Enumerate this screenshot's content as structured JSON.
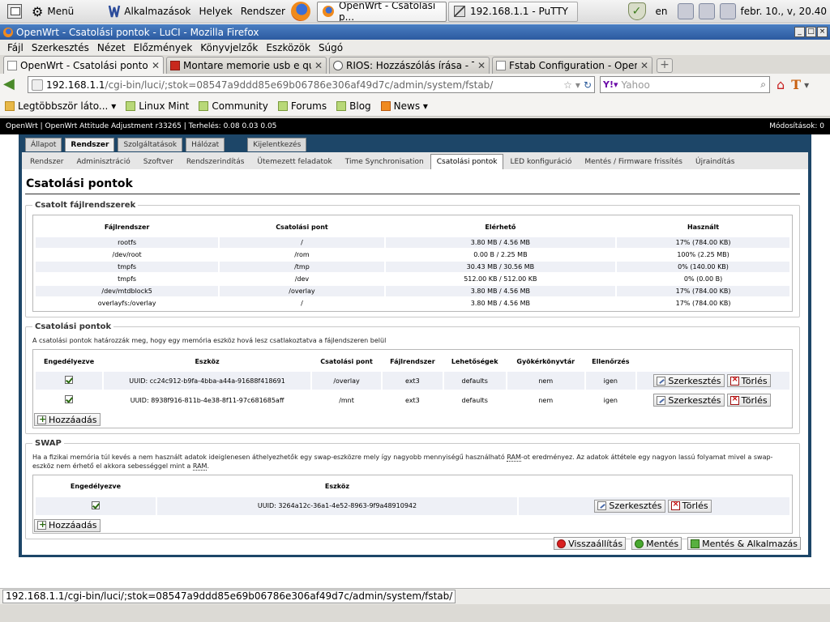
{
  "syspanel": {
    "menu_label": "Menü",
    "apps": "Alkalmazások",
    "places": "Helyek",
    "system": "Rendszer",
    "tasks": [
      {
        "label": "OpenWrt - Csatolási p..."
      },
      {
        "label": "192.168.1.1 - PuTTY"
      }
    ],
    "lang": "en",
    "clock": "febr. 10., v, 20.40"
  },
  "firefox": {
    "title": "OpenWrt - Csatolási pontok - LuCI - Mozilla Firefox",
    "menu": [
      "Fájl",
      "Szerkesztés",
      "Nézet",
      "Előzmények",
      "Könyvjelzők",
      "Eszközök",
      "Súgó"
    ],
    "tabs": [
      {
        "label": "OpenWrt - Csatolási pontok - ...",
        "close": "✕"
      },
      {
        "label": "Montare memorie usb e qual...",
        "close": "✕"
      },
      {
        "label": "RIOS: Hozzászólás írása - Té...",
        "close": "✕"
      },
      {
        "label": "Fstab Configuration - OpenW...",
        "close": "✕"
      }
    ],
    "url_host": "192.168.1.1",
    "url_path": "/cgi-bin/luci/;stok=08547a9ddd85e69b06786e306af49d7c/admin/system/fstab/",
    "search_placeholder": "Yahoo",
    "bookmarks": [
      "Legtöbbször láto...",
      "Linux Mint",
      "Community",
      "Forums",
      "Blog",
      "News"
    ],
    "status_url": "192.168.1.1/cgi-bin/luci/;stok=08547a9ddd85e69b06786e306af49d7c/admin/system/fstab/"
  },
  "luci": {
    "header_left": "OpenWrt | OpenWrt Attitude Adjustment r33265 | Terhelés: 0.08 0.03 0.05",
    "header_right": "Módosítások: 0",
    "main_tabs": [
      "Állapot",
      "Rendszer",
      "Szolgáltatások",
      "Hálózat",
      "Kijelentkezés"
    ],
    "sub_tabs": [
      "Rendszer",
      "Adminisztráció",
      "Szoftver",
      "Rendszerindítás",
      "Ütemezett feladatok",
      "Time Synchronisation",
      "Csatolási pontok",
      "LED konfiguráció",
      "Mentés / Firmware frissítés",
      "Újraindítás"
    ],
    "page_title": "Csatolási pontok",
    "mounted": {
      "legend": "Csatolt fájlrendszerek",
      "headers": [
        "Fájlrendszer",
        "Csatolási pont",
        "Elérhető",
        "Használt"
      ],
      "rows": [
        [
          "rootfs",
          "/",
          "3.80 MB / 4.56 MB",
          "17% (784.00 KB)"
        ],
        [
          "/dev/root",
          "/rom",
          "0.00 B / 2.25 MB",
          "100% (2.25 MB)"
        ],
        [
          "tmpfs",
          "/tmp",
          "30.43 MB / 30.56 MB",
          "0% (140.00 KB)"
        ],
        [
          "tmpfs",
          "/dev",
          "512.00 KB / 512.00 KB",
          "0% (0.00 B)"
        ],
        [
          "/dev/mtdblock5",
          "/overlay",
          "3.80 MB / 4.56 MB",
          "17% (784.00 KB)"
        ],
        [
          "overlayfs:/overlay",
          "/",
          "3.80 MB / 4.56 MB",
          "17% (784.00 KB)"
        ]
      ]
    },
    "mounts": {
      "legend": "Csatolási pontok",
      "desc": "A csatolási pontok határozzák meg, hogy egy memória eszköz hová lesz csatlakoztatva a fájlendszeren belül",
      "headers": [
        "Engedélyezve",
        "Eszköz",
        "Csatolási pont",
        "Fájlrendszer",
        "Lehetőségek",
        "Gyökérkönyvtár",
        "Ellenőrzés"
      ],
      "rows": [
        {
          "device": "UUID: cc24c912-b9fa-4bba-a44a-91688f418691",
          "mount": "/overlay",
          "fs": "ext3",
          "options": "defaults",
          "root": "nem",
          "check": "igen"
        },
        {
          "device": "UUID: 8938f916-811b-4e38-8f11-97c681685aff",
          "mount": "/mnt",
          "fs": "ext3",
          "options": "defaults",
          "root": "nem",
          "check": "igen"
        }
      ],
      "edit_label": "Szerkesztés",
      "delete_label": "Törlés",
      "add_label": "Hozzáadás"
    },
    "swap": {
      "legend": "SWAP",
      "desc_a": "Ha a fizikai memória túl kevés a nem használt adatok ideiglenesen áthelyezhetők egy swap-eszközre mely így nagyobb mennyiségű használható ",
      "desc_ram1": "RAM",
      "desc_b": "-ot eredményez. Az adatok áttétele egy nagyon lassú folyamat mivel a swap-eszköz nem érhető el akkora sebességgel mint a ",
      "desc_ram2": "RAM",
      "desc_c": ".",
      "headers": [
        "Engedélyezve",
        "Eszköz"
      ],
      "rows": [
        {
          "device": "UUID: 3264a12c-36a1-4e52-8963-9f9a48910942"
        }
      ],
      "edit_label": "Szerkesztés",
      "delete_label": "Törlés",
      "add_label": "Hozzáadás"
    },
    "buttons": {
      "reset": "Visszaállítás",
      "save": "Mentés",
      "apply": "Mentés & Alkalmazás"
    }
  }
}
